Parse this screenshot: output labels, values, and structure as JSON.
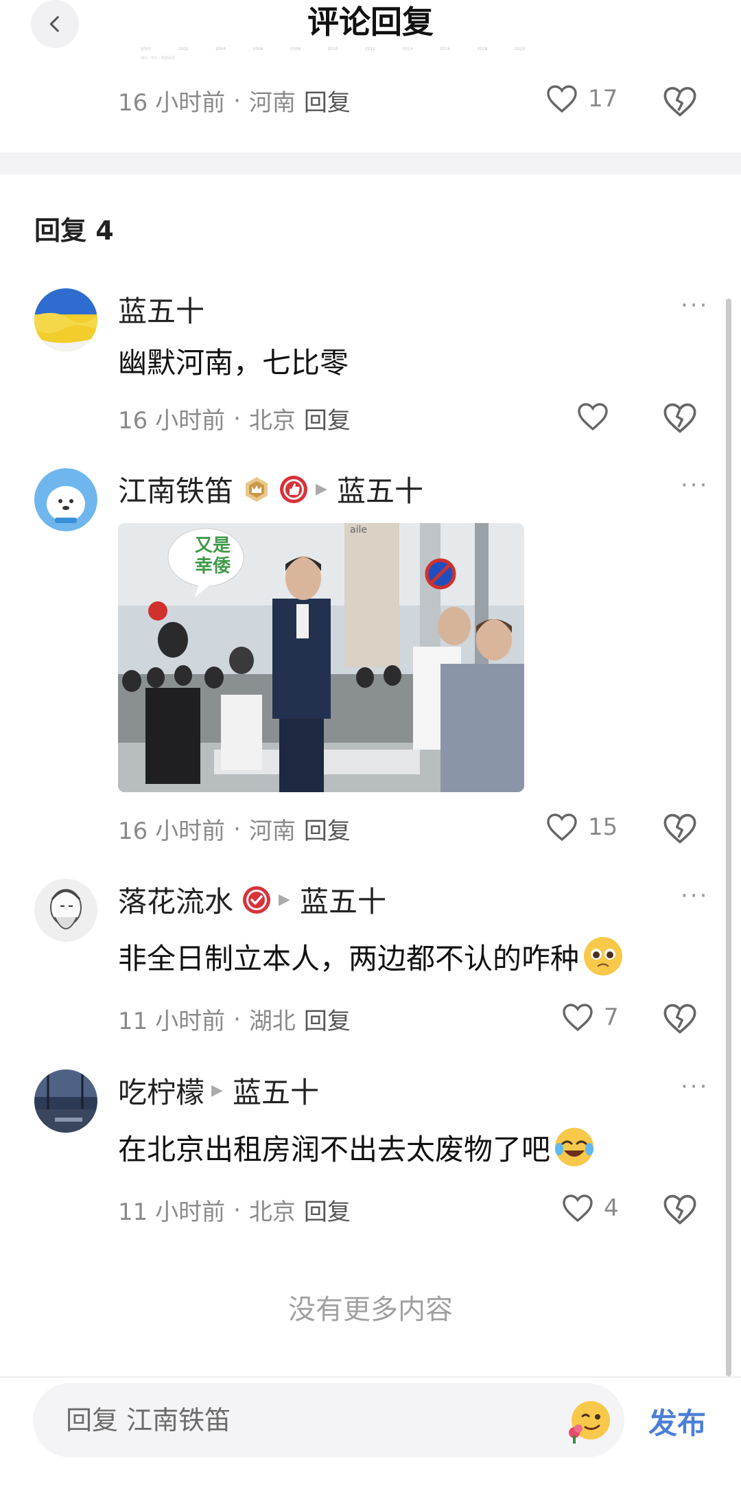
{
  "header": {
    "title": "评论回复",
    "faded_axis_ticks": [
      "2000",
      "2002",
      "2004",
      "2006",
      "2008",
      "2010",
      "2012",
      "2014",
      "2016",
      "2018",
      "2020"
    ],
    "faded_caption": "湖北 / 年份 / 数据来源"
  },
  "parent_comment": {
    "time": "16 小时前",
    "location": "河南",
    "reply_label": "回复",
    "likes": "17"
  },
  "replies_heading": "回复 4",
  "replies": [
    {
      "author": "蓝五十",
      "text": "幽默河南，七比零",
      "time": "16 小时前",
      "location": "北京",
      "reply_label": "回复",
      "likes": ""
    },
    {
      "author": "江南铁笛",
      "reply_to": "蓝五十",
      "image_caption": "又是\n幸倭",
      "image_sign": "aile",
      "time": "16 小时前",
      "location": "河南",
      "reply_label": "回复",
      "likes": "15"
    },
    {
      "author": "落花流水",
      "reply_to": "蓝五十",
      "text": "非全日制立本人，两边都不认的咋种",
      "time": "11 小时前",
      "location": "湖北",
      "reply_label": "回复",
      "likes": "7"
    },
    {
      "author": "吃柠檬",
      "reply_to": "蓝五十",
      "text": "在北京出租房润不出去太废物了吧",
      "time": "11 小时前",
      "location": "北京",
      "reply_label": "回复",
      "likes": "4"
    }
  ],
  "no_more": "没有更多内容",
  "bottom": {
    "input_placeholder": "回复 江南铁笛",
    "publish_label": "发布"
  },
  "colors": {
    "accent": "#4a7fd6",
    "muted": "#8a8a8a",
    "divider": "#f3f3f5"
  },
  "icons": [
    "back-icon",
    "heart-icon",
    "broken-heart-icon",
    "more-icon",
    "crown-badge-icon",
    "thumb-badge-icon",
    "check-badge-icon",
    "emoji-icon"
  ]
}
